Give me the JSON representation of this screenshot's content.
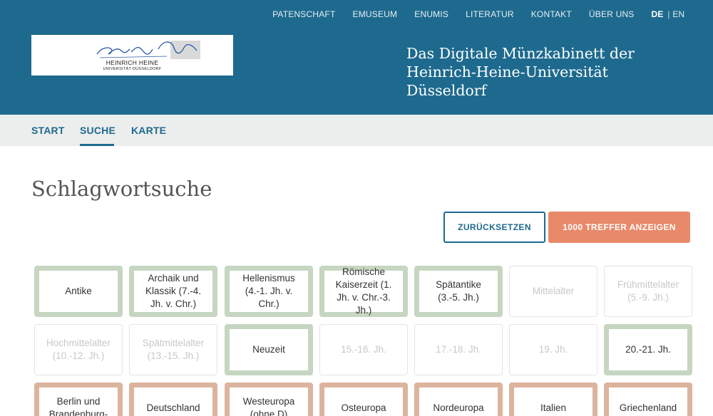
{
  "topnav": {
    "items": [
      "PATENSCHAFT",
      "EMUSEUM",
      "ENUMIS",
      "LITERATUR",
      "KONTAKT",
      "ÜBER UNS"
    ],
    "lang_de": "DE",
    "lang_sep": "|",
    "lang_en": "EN"
  },
  "logo": {
    "name": "HEINRICH HEINE",
    "sub": "UNIVERSITÄT DÜSSELDORF"
  },
  "site_title": {
    "line1": "Das Digitale Münzkabinett der",
    "line2": "Heinrich-Heine-Universität Düsseldorf"
  },
  "subnav": {
    "start": "START",
    "suche": "SUCHE",
    "karte": "KARTE",
    "active": "SUCHE"
  },
  "main": {
    "title": "Schlagwortsuche",
    "reset_label": "ZURÜCKSETZEN",
    "show_label": "1000 TREFFER ANZEIGEN"
  },
  "colors": {
    "header": "#1e6a8e",
    "accent": "#e8896a",
    "tile_green": "#c6d6c1",
    "tile_brown": "#dcb49e"
  },
  "tiles": [
    {
      "label": "Antike",
      "state": "selected"
    },
    {
      "label": "Archaik und Klassik (7.-4. Jh. v. Chr.)",
      "state": "selected"
    },
    {
      "label": "Hellenismus (4.-1. Jh. v. Chr.)",
      "state": "selected"
    },
    {
      "label": "Römische Kaiserzeit (1. Jh. v. Chr.-3. Jh.)",
      "state": "selected"
    },
    {
      "label": "Spätantike (3.-5. Jh.)",
      "state": "selected"
    },
    {
      "label": "Mittelalter",
      "state": "disabled"
    },
    {
      "label": "Frühmittelalter (5.-9. Jh.)",
      "state": "disabled"
    },
    {
      "label": "Hochmittelalter (10.-12. Jh.)",
      "state": "disabled"
    },
    {
      "label": "Spätmittelalter (13.-15. Jh.)",
      "state": "disabled"
    },
    {
      "label": "Neuzeit",
      "state": "selected"
    },
    {
      "label": "15.-16. Jh.",
      "state": "disabled"
    },
    {
      "label": "17.-18. Jh.",
      "state": "disabled"
    },
    {
      "label": "19. Jh.",
      "state": "disabled"
    },
    {
      "label": "20.-21. Jh.",
      "state": "selected"
    },
    {
      "label": "Berlin und Brandenburg-",
      "state": "selected"
    },
    {
      "label": "Deutschland",
      "state": "selected"
    },
    {
      "label": "Westeuropa (ohne D)",
      "state": "selected"
    },
    {
      "label": "Osteuropa",
      "state": "selected"
    },
    {
      "label": "Nordeuropa",
      "state": "selected"
    },
    {
      "label": "Italien",
      "state": "selected"
    },
    {
      "label": "Griechenland",
      "state": "selected"
    }
  ]
}
